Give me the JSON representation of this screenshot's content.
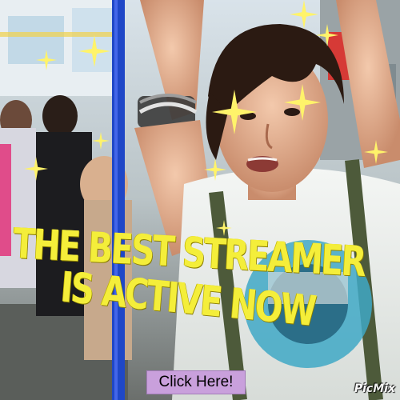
{
  "headline": {
    "line1": "THE BEST STREAMER",
    "line2": "IS ACTIVE NOW"
  },
  "cta": {
    "label": "Click Here!"
  },
  "watermark": {
    "text": "PicMix"
  },
  "colors": {
    "headline": "#f4ee3a",
    "cta_background": "#c9a0dc",
    "sparkle": "#fff36a"
  },
  "icons": [
    "sparkle-icon"
  ]
}
